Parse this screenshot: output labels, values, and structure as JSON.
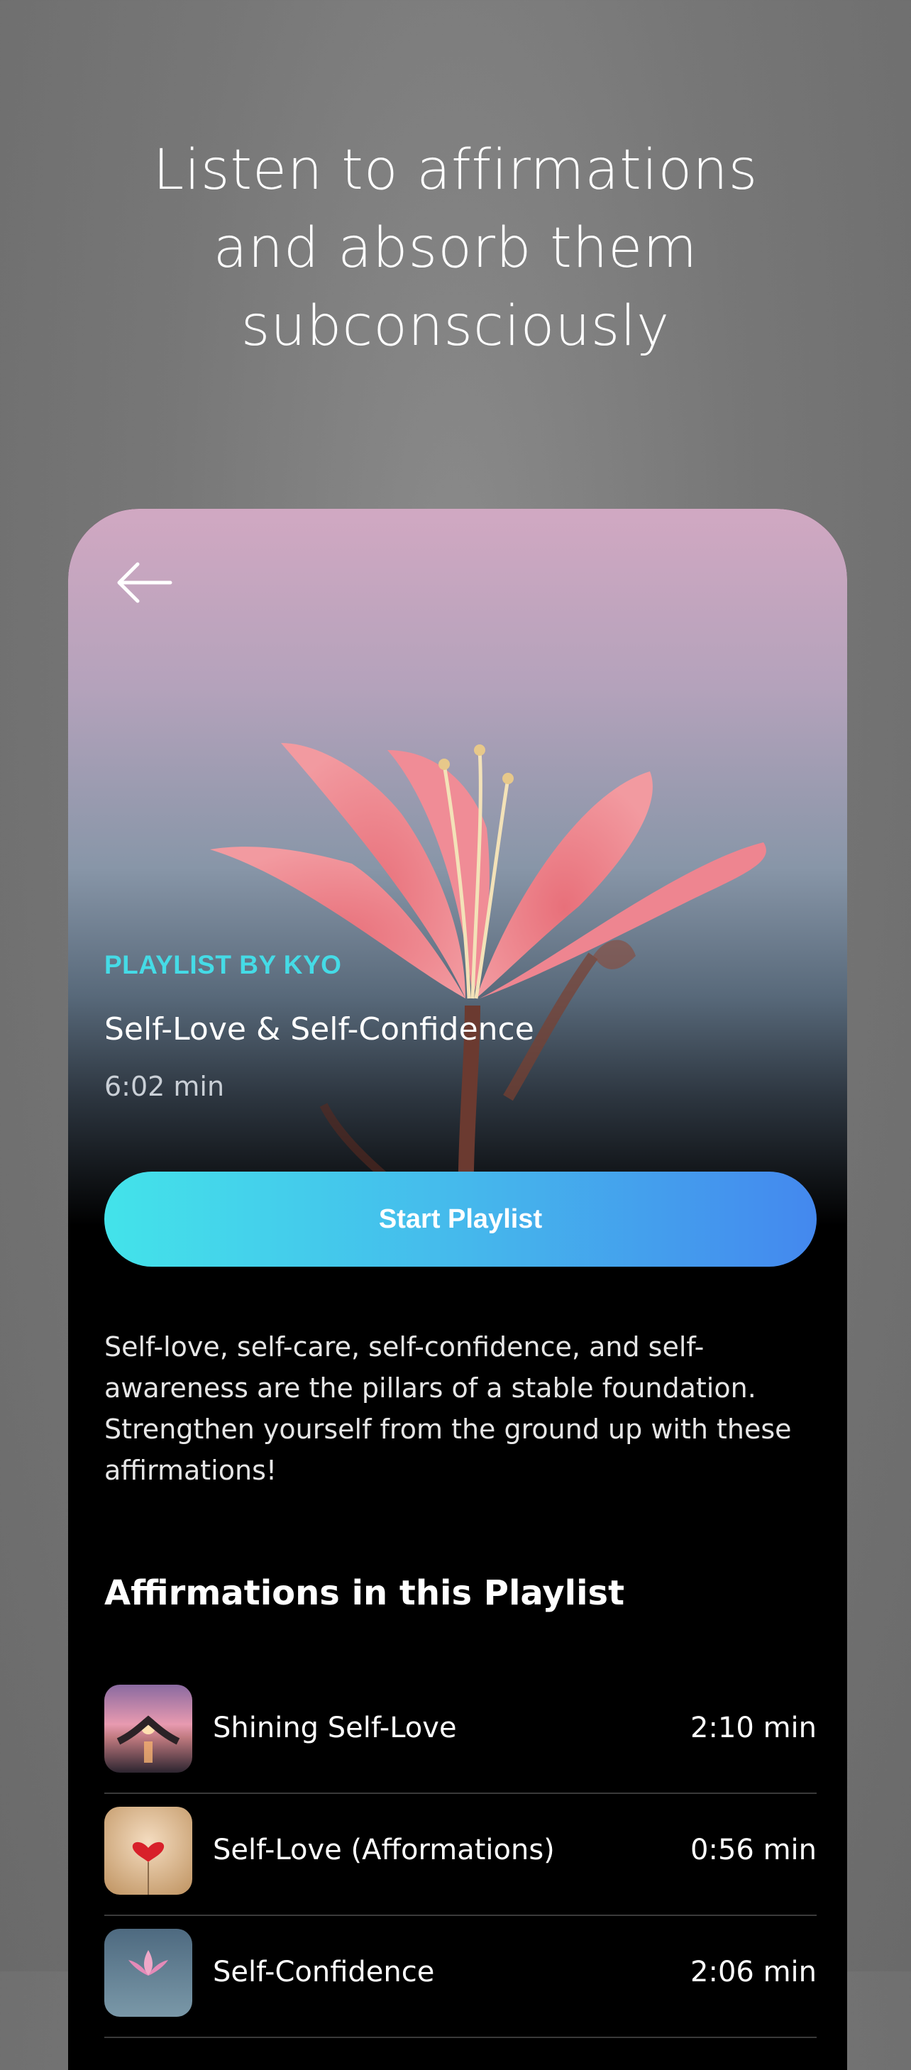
{
  "headline": {
    "line1": "Listen to affirmations",
    "line2": "and absorb them",
    "line3": "subconsciously"
  },
  "playlist": {
    "overline": "PLAYLIST BY KYO",
    "title": "Self-Love & Self-Confidence",
    "duration": "6:02 min",
    "start_label": "Start Playlist",
    "description": "Self-love, self-care, self-confidence, and self-awareness are the pillars of a stable foundation. Strengthen yourself from the ground up with these affirmations!",
    "section_title": "Affirmations in this Playlist",
    "items": [
      {
        "name": "Shining Self-Love",
        "duration": "2:10 min"
      },
      {
        "name": "Self-Love (Afformations)",
        "duration": "0:56 min"
      },
      {
        "name": "Self-Confidence",
        "duration": "2:06 min"
      }
    ]
  },
  "colors": {
    "accent": "#45dbe6",
    "button_start": "#43e3ea",
    "button_end": "#4488ee"
  },
  "icons": {
    "back": "arrow-left-icon"
  }
}
